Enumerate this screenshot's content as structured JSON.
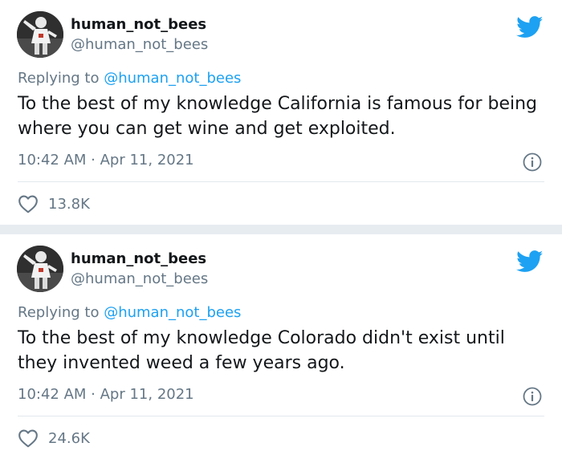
{
  "tweets": [
    {
      "author_name": "human_not_bees",
      "author_handle": "@human_not_bees",
      "reply_prefix": "Replying to ",
      "reply_to": "@human_not_bees",
      "text": "To the best of my knowledge California is famous for being where you can get wine and get exploited.",
      "timestamp": "10:42 AM · Apr 11, 2021",
      "likes": "13.8K"
    },
    {
      "author_name": "human_not_bees",
      "author_handle": "@human_not_bees",
      "reply_prefix": "Replying to ",
      "reply_to": "@human_not_bees",
      "text": "To the best of my knowledge Colorado didn't exist until they invented weed a few years ago.",
      "timestamp": "10:42 AM · Apr 11, 2021",
      "likes": "24.6K"
    }
  ],
  "icons": {
    "brand": "twitter-bird-icon",
    "info": "info-icon",
    "like": "heart-icon"
  },
  "colors": {
    "accent": "#1da1f2",
    "secondary_text": "#657786",
    "separator": "#e6ecf0"
  }
}
